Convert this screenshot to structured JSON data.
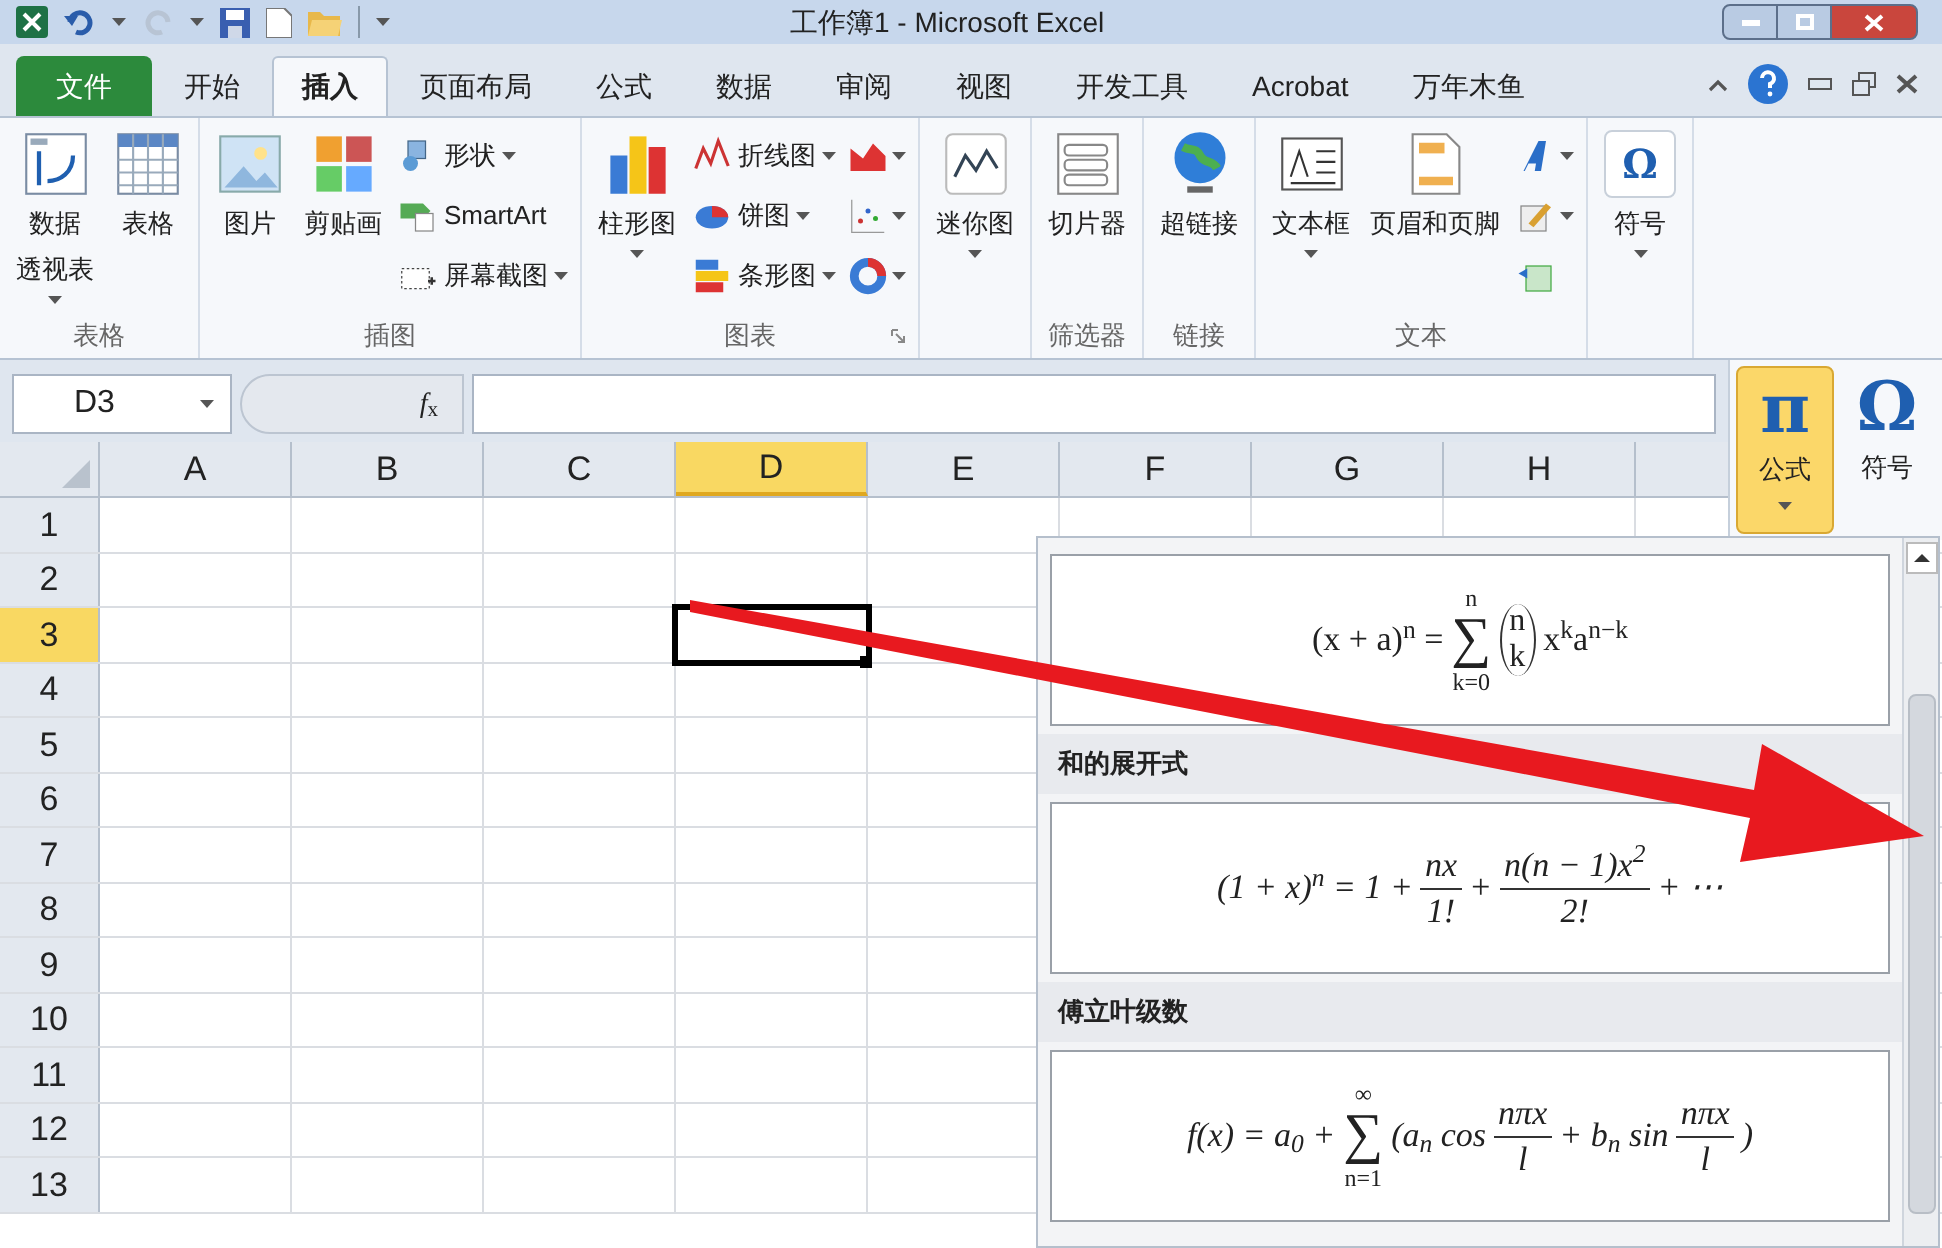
{
  "window": {
    "title": "工作簿1  -  Microsoft Excel"
  },
  "tabs": [
    {
      "label": "文件",
      "kind": "file",
      "selected": false
    },
    {
      "label": "开始",
      "kind": "tab",
      "selected": false
    },
    {
      "label": "插入",
      "kind": "tab",
      "selected": true
    },
    {
      "label": "页面布局",
      "kind": "tab",
      "selected": false
    },
    {
      "label": "公式",
      "kind": "tab",
      "selected": false
    },
    {
      "label": "数据",
      "kind": "tab",
      "selected": false
    },
    {
      "label": "审阅",
      "kind": "tab",
      "selected": false
    },
    {
      "label": "视图",
      "kind": "tab",
      "selected": false
    },
    {
      "label": "开发工具",
      "kind": "tab",
      "selected": false
    },
    {
      "label": "Acrobat",
      "kind": "tab",
      "selected": false
    },
    {
      "label": "万年木鱼",
      "kind": "tab",
      "selected": false
    }
  ],
  "ribbon": [
    {
      "label": "表格",
      "columns": [
        [
          {
            "kind": "large",
            "lines": [
              "数据",
              "透视表"
            ],
            "dropdown": true
          }
        ],
        [
          {
            "kind": "large",
            "lines": [
              "表格"
            ],
            "dropdown": false
          }
        ]
      ]
    },
    {
      "label": "插图",
      "columns": [
        [
          {
            "kind": "large",
            "lines": [
              "图片"
            ],
            "dropdown": false
          }
        ],
        [
          {
            "kind": "large",
            "lines": [
              "剪贴画"
            ],
            "dropdown": false
          }
        ],
        [
          {
            "kind": "small",
            "label": "形状",
            "dropdown": true
          },
          {
            "kind": "small",
            "label": "SmartArt",
            "dropdown": false
          },
          {
            "kind": "small",
            "label": "屏幕截图",
            "dropdown": true
          }
        ]
      ]
    },
    {
      "label": "图表",
      "launcher": true,
      "columns": [
        [
          {
            "kind": "large",
            "lines": [
              "柱形图"
            ],
            "dropdown": true
          }
        ],
        [
          {
            "kind": "small",
            "label": "折线图",
            "dropdown": true
          },
          {
            "kind": "small",
            "label": "饼图",
            "dropdown": true
          },
          {
            "kind": "small",
            "label": "条形图",
            "dropdown": true
          }
        ],
        [
          {
            "kind": "icon",
            "dropdown": true
          },
          {
            "kind": "icon",
            "dropdown": true
          },
          {
            "kind": "icon",
            "dropdown": true
          }
        ]
      ]
    },
    {
      "columns": [
        [
          {
            "kind": "large",
            "lines": [
              "迷你图"
            ],
            "dropdown": true
          }
        ]
      ]
    },
    {
      "label": "筛选器",
      "columns": [
        [
          {
            "kind": "large",
            "lines": [
              "切片器"
            ],
            "dropdown": false
          }
        ]
      ]
    },
    {
      "label": "链接",
      "columns": [
        [
          {
            "kind": "large",
            "lines": [
              "超链接"
            ],
            "dropdown": false
          }
        ]
      ]
    },
    {
      "label": "文本",
      "columns": [
        [
          {
            "kind": "large",
            "lines": [
              "文本框"
            ],
            "dropdown": true
          }
        ],
        [
          {
            "kind": "large",
            "lines": [
              "页眉和页脚"
            ],
            "dropdown": false
          }
        ],
        [
          {
            "kind": "icon",
            "dropdown": true
          },
          {
            "kind": "icon",
            "dropdown": true
          },
          {
            "kind": "icon",
            "dropdown": false
          }
        ]
      ]
    },
    {
      "columns": [
        [
          {
            "kind": "large",
            "glyph": "Ω",
            "lines": [
              "符号"
            ],
            "dropdown": true
          }
        ]
      ]
    }
  ],
  "formula_bar": {
    "name_box": "D3",
    "fx": "*f*$_{x}$"
  },
  "columns": [
    {
      "label": "A",
      "selected": false
    },
    {
      "label": "B",
      "selected": false
    },
    {
      "label": "C",
      "selected": false
    },
    {
      "label": "D",
      "selected": true
    },
    {
      "label": "E",
      "selected": false
    },
    {
      "label": "F",
      "selected": false
    },
    {
      "label": "G",
      "selected": false
    },
    {
      "label": "H",
      "selected": false
    }
  ],
  "rows": [
    {
      "label": "1",
      "selected": false
    },
    {
      "label": "2",
      "selected": false
    },
    {
      "label": "3",
      "selected": true
    },
    {
      "label": "4",
      "selected": false
    },
    {
      "label": "5",
      "selected": false
    },
    {
      "label": "6",
      "selected": false
    },
    {
      "label": "7",
      "selected": false
    },
    {
      "label": "8",
      "selected": false
    },
    {
      "label": "9",
      "selected": false
    },
    {
      "label": "10",
      "selected": false
    },
    {
      "label": "11",
      "selected": false
    },
    {
      "label": "12",
      "selected": false
    },
    {
      "label": "13",
      "selected": false
    }
  ],
  "equation_buttons": [
    {
      "glyph": "π",
      "label": "公式",
      "selected": true,
      "dropdown": true
    },
    {
      "glyph": "Ω",
      "label": "符号",
      "selected": false,
      "dropdown": false
    }
  ],
  "gallery": [
    {
      "italic": false,
      "parts": [
        {
          "kind": "text",
          "s": "(x + a)$^{n}$ ="
        },
        {
          "kind": "sum",
          "sign": "∑",
          "over": "n",
          "under": "k=0"
        },
        {
          "kind": "binom",
          "top": "n",
          "bottom": "k"
        },
        {
          "kind": "text",
          "s": "x$^{k}$a$^{n−k}$"
        }
      ]
    },
    {
      "title": "和的展开式",
      "italic": true,
      "parts": [
        {
          "kind": "text",
          "s": "(1 + x)$^{n}$ = 1 +"
        },
        {
          "kind": "frac",
          "num": "nx",
          "den": "1!"
        },
        {
          "kind": "text",
          "s": "+"
        },
        {
          "kind": "frac",
          "num": "n(n − 1)x$^{2}$",
          "den": "2!"
        },
        {
          "kind": "text",
          "s": "+ ⋯"
        }
      ]
    },
    {
      "title": "傅立叶级数",
      "italic": true,
      "parts": [
        {
          "kind": "text",
          "s": "f(x) = a$_{0}$ +"
        },
        {
          "kind": "sum",
          "sign": "∑",
          "over": "∞",
          "under": "n=1"
        },
        {
          "kind": "text",
          "s": "(a$_{n}$ cos"
        },
        {
          "kind": "frac",
          "num": "nπx",
          "den": "l"
        },
        {
          "kind": "text",
          "s": "+ b$_{n}$ sin"
        },
        {
          "kind": "frac",
          "num": "nπx",
          "den": "l"
        },
        {
          "kind": "text",
          "s": ")"
        }
      ]
    }
  ]
}
